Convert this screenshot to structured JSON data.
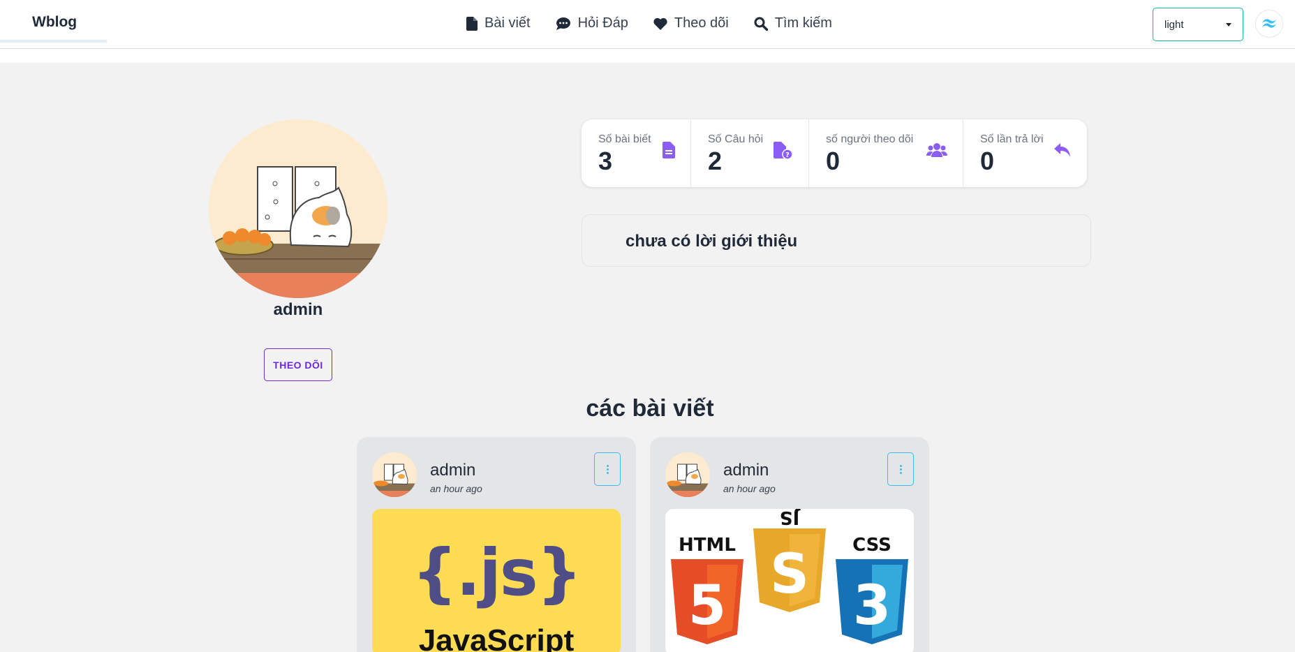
{
  "brand": "Wblog",
  "nav": {
    "posts": "Bài viết",
    "qa": "Hỏi Đáp",
    "following": "Theo dõi",
    "search": "Tìm kiếm"
  },
  "theme_select": {
    "value": "light"
  },
  "profile": {
    "name": "admin",
    "follow_label": "THEO DÕI",
    "intro": "chưa có lời giới thiệu"
  },
  "stats": [
    {
      "title": "Số bài biết",
      "value": "3",
      "icon": "file-text-icon"
    },
    {
      "title": "Số Câu hỏi",
      "value": "2",
      "icon": "file-question-icon"
    },
    {
      "title": "số người theo dõi",
      "value": "0",
      "icon": "users-icon"
    },
    {
      "title": "Số lần trả lời",
      "value": "0",
      "icon": "reply-icon"
    }
  ],
  "section_title": "các bài viết",
  "posts": [
    {
      "author": "admin",
      "time": "an hour ago",
      "image_text": "{.js}",
      "image_caption": "JavaScript"
    },
    {
      "author": "admin",
      "time": "an hour ago",
      "image_labels": [
        "HTML",
        "JS",
        "CSS"
      ],
      "image_digits": [
        "5",
        "S",
        "3"
      ]
    }
  ],
  "colors": {
    "accent": "#7c3aed",
    "teal_border": "#14b8a6",
    "menu_border": "#38bdf8",
    "background": "#f2f2f2"
  }
}
